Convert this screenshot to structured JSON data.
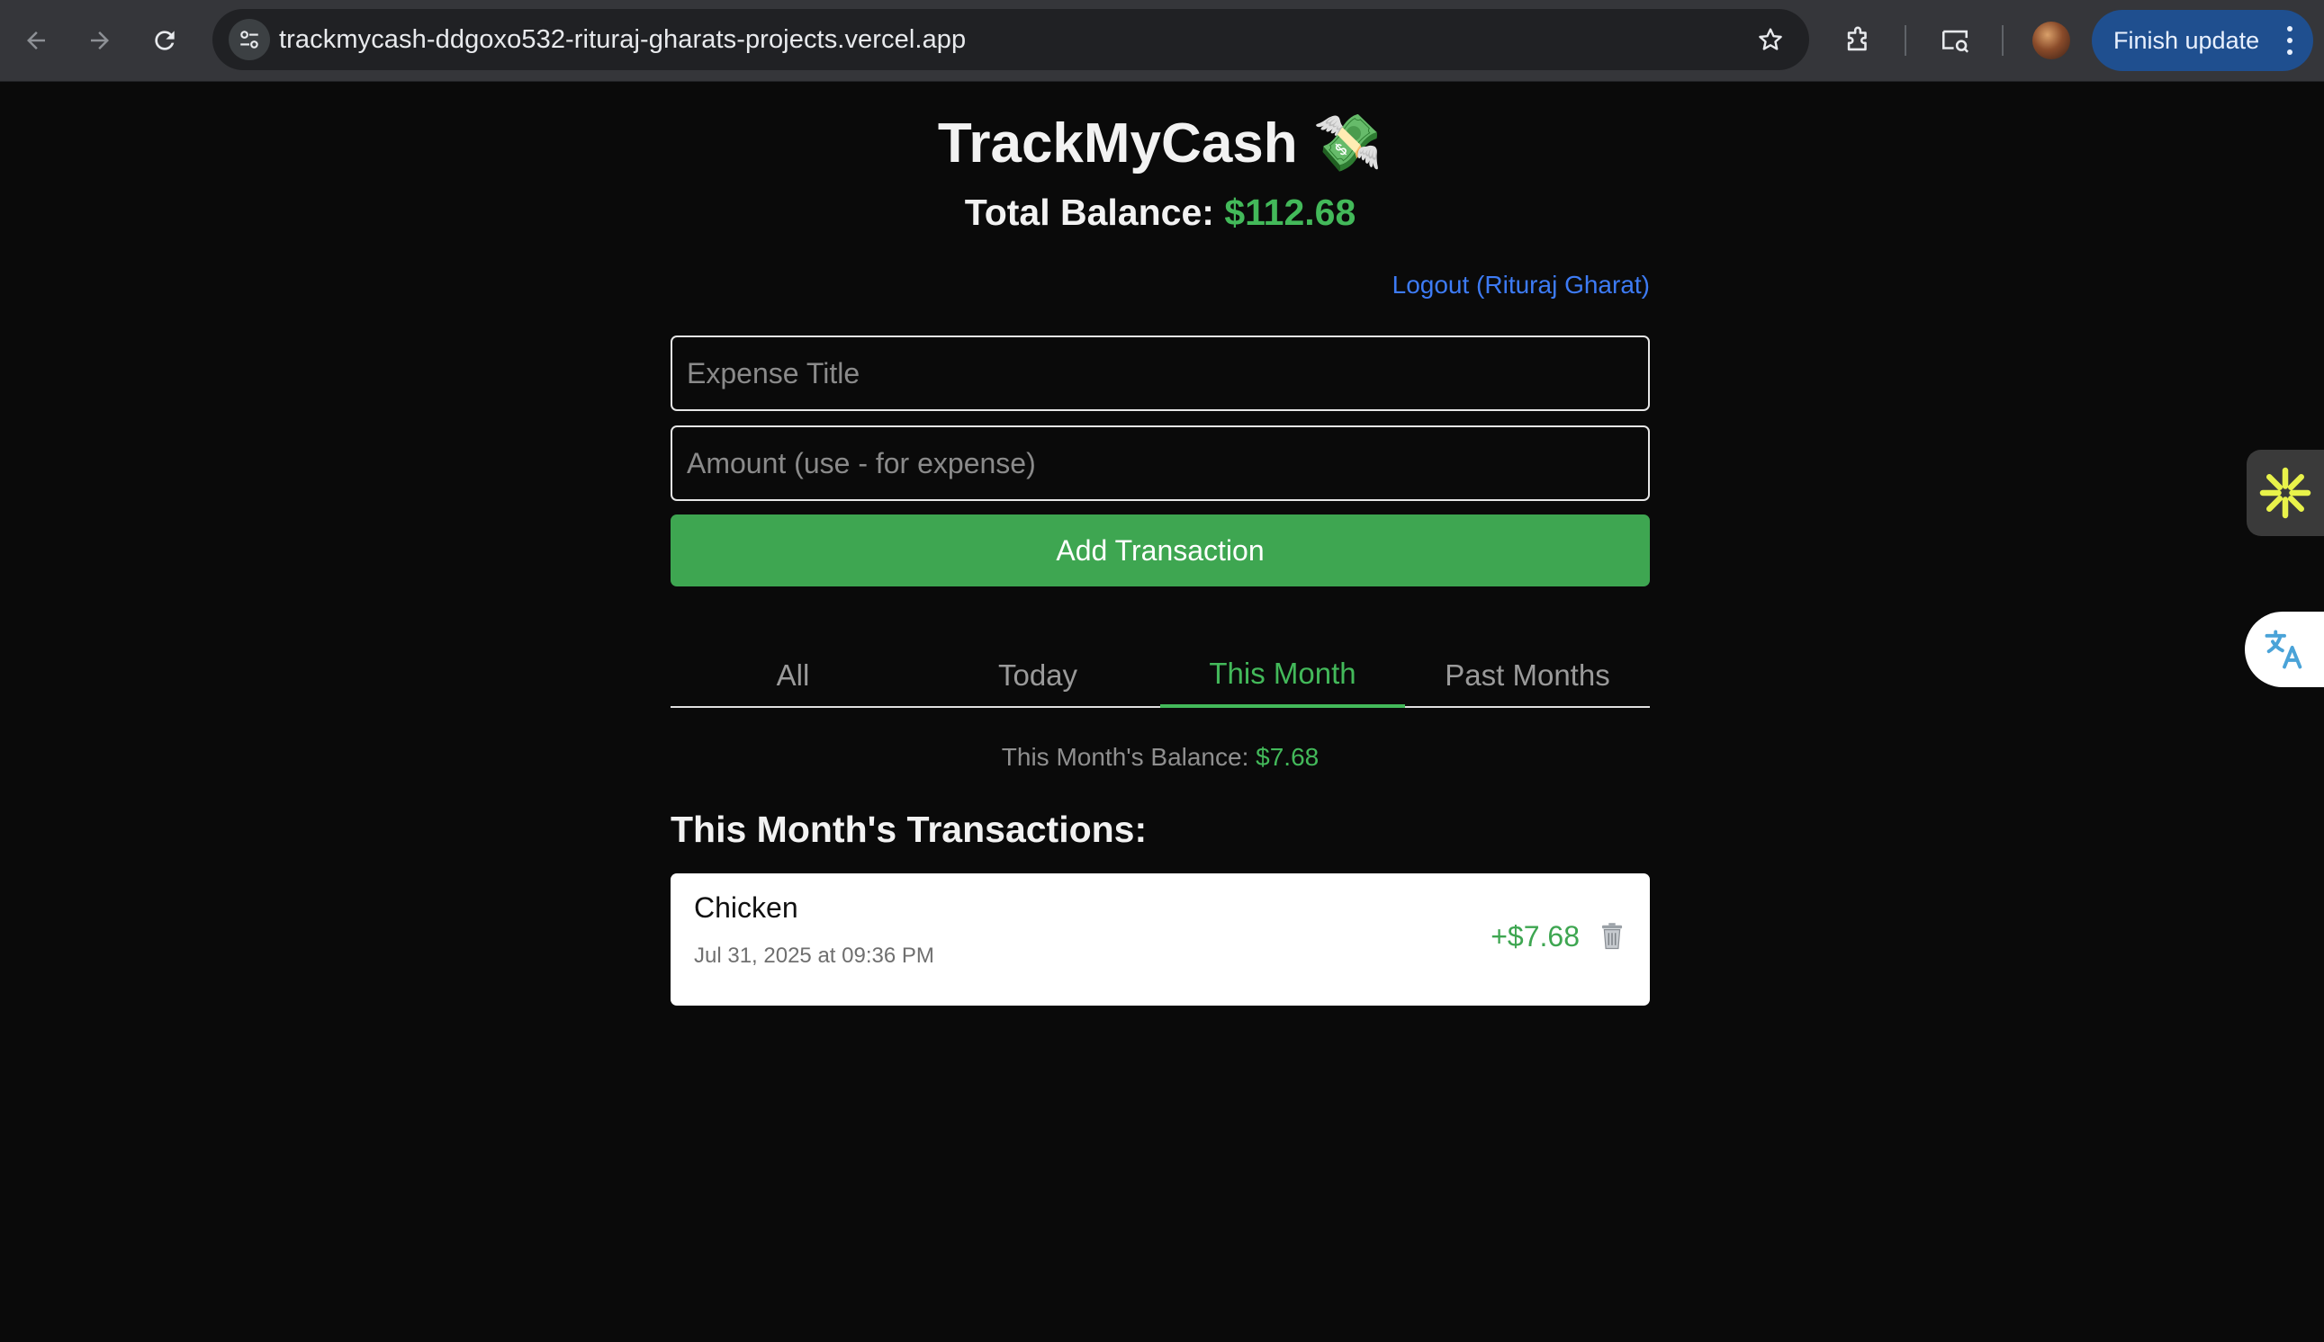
{
  "browser": {
    "url": "trackmycash-ddgoxo532-rituraj-gharats-projects.vercel.app",
    "finish_update_label": "Finish update"
  },
  "app": {
    "title": "TrackMyCash",
    "title_emoji": "💸",
    "total_balance_label": "Total Balance:",
    "total_balance_value": "$112.68",
    "logout_label": "Logout (Rituraj Gharat)"
  },
  "form": {
    "title_placeholder": "Expense Title",
    "title_value": "",
    "amount_placeholder": "Amount (use - for expense)",
    "amount_value": "",
    "add_button_label": "Add Transaction"
  },
  "tabs": [
    {
      "label": "All",
      "active": false
    },
    {
      "label": "Today",
      "active": false
    },
    {
      "label": "This Month",
      "active": true
    },
    {
      "label": "Past Months",
      "active": false
    }
  ],
  "period_balance": {
    "label": "This Month's Balance:",
    "value": "$7.68"
  },
  "transactions": {
    "heading": "This Month's Transactions:",
    "items": [
      {
        "title": "Chicken",
        "date": "Jul 31, 2025 at 09:36 PM",
        "amount": "+$7.68"
      }
    ]
  },
  "colors": {
    "accent_green": "#43b95a",
    "button_green": "#3ea651",
    "link_blue": "#3d7bf5",
    "background": "#0a0a0a"
  },
  "icons": {
    "back": "arrow-left-icon",
    "forward": "arrow-right-icon",
    "reload": "reload-icon",
    "site_settings": "tune-icon",
    "bookmark": "star-icon",
    "extensions": "puzzle-icon",
    "cast": "cast-search-icon",
    "delete": "trash-icon",
    "widget": "asterisk-icon",
    "translate": "translate-icon"
  }
}
